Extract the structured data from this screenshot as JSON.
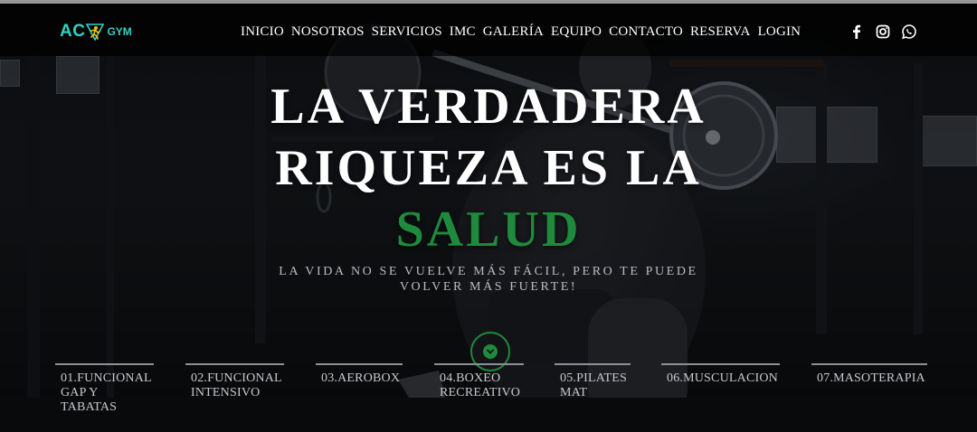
{
  "brand": {
    "logo_main": "AC",
    "logo_sub": "GYM",
    "accent_color": "#2fd1c4",
    "logo_icon": "runner-icon"
  },
  "nav": {
    "items": [
      {
        "label": "INICIO"
      },
      {
        "label": "NOSOTROS"
      },
      {
        "label": "SERVICIOS"
      },
      {
        "label": "IMC"
      },
      {
        "label": "GALERÍA"
      },
      {
        "label": "EQUIPO"
      },
      {
        "label": "CONTACTO"
      },
      {
        "label": "RESERVA"
      },
      {
        "label": "LOGIN"
      }
    ]
  },
  "social": {
    "icons": [
      "facebook-icon",
      "instagram-icon",
      "whatsapp-icon"
    ]
  },
  "hero": {
    "line1": "LA VERDADERA",
    "line2": "RIQUEZA ES LA",
    "line3": "SALUD",
    "tagline_line1": "LA VIDA NO SE VUELVE MÁS FÁCIL, PERO TE PUEDE",
    "tagline_line2": "VOLVER MÁS FUERTE!",
    "accent_color": "#1f8a3d",
    "scroll_icon": "chevron-down-icon"
  },
  "services": [
    {
      "label": "01.FUNCIONAL GAP Y TABATAS"
    },
    {
      "label": "02.FUNCIONAL INTENSIVO"
    },
    {
      "label": "03.AEROBOX"
    },
    {
      "label": "04.BOXEO RECREATIVO"
    },
    {
      "label": "05.PILATES MAT"
    },
    {
      "label": "06.MUSCULACION"
    },
    {
      "label": "07.MASOTERAPIA"
    }
  ]
}
